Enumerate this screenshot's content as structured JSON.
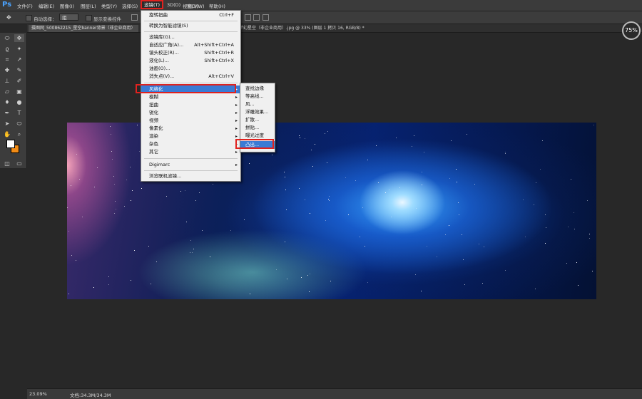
{
  "app": {
    "logo": "Ps"
  },
  "menubar": {
    "items": [
      "文件(F)",
      "编辑(E)",
      "图像(I)",
      "图层(L)",
      "类型(Y)",
      "选择(S)",
      "滤镜(T)",
      "3D(D)",
      "视图(V)",
      "窗口(W)",
      "帮助(H)"
    ]
  },
  "optbar": {
    "auto_select_label": "自动选择：",
    "auto_select_value": "组",
    "show_transform_label": "显示变换控件"
  },
  "tabs": {
    "left": "摄图网_500862215_星空banner背景（非企业商用）",
    "right": "梦幻星空（非企业商用）.jpg @ 33% (图层 1 拷贝 16, RGB/8) *"
  },
  "zoom_badge": "75%",
  "filter_menu": {
    "items": [
      {
        "label": "旋转扭曲",
        "shortcut": "Ctrl+F"
      },
      {
        "label": "转换为智能滤镜(S)",
        "shortcut": ""
      },
      {
        "label": "滤镜库(G)...",
        "shortcut": ""
      },
      {
        "label": "自适应广角(A)...",
        "shortcut": "Alt+Shift+Ctrl+A"
      },
      {
        "label": "镜头校正(R)...",
        "shortcut": "Shift+Ctrl+R"
      },
      {
        "label": "液化(L)...",
        "shortcut": "Shift+Ctrl+X"
      },
      {
        "label": "油画(O)...",
        "shortcut": ""
      },
      {
        "label": "消失点(V)...",
        "shortcut": "Alt+Ctrl+V"
      },
      {
        "label": "风格化",
        "shortcut": ""
      },
      {
        "label": "模糊",
        "shortcut": ""
      },
      {
        "label": "扭曲",
        "shortcut": ""
      },
      {
        "label": "锐化",
        "shortcut": ""
      },
      {
        "label": "视频",
        "shortcut": ""
      },
      {
        "label": "像素化",
        "shortcut": ""
      },
      {
        "label": "渲染",
        "shortcut": ""
      },
      {
        "label": "杂色",
        "shortcut": ""
      },
      {
        "label": "其它",
        "shortcut": ""
      },
      {
        "label": "Digimarc",
        "shortcut": ""
      },
      {
        "label": "浏览联机滤镜...",
        "shortcut": ""
      }
    ],
    "submenu_arrow": "▸"
  },
  "stylize_submenu": {
    "items": [
      "查找边缘",
      "等高线...",
      "风...",
      "浮雕效果...",
      "扩散...",
      "拼贴...",
      "曝光过度",
      "凸出..."
    ]
  },
  "status": {
    "zoom": "23.09%",
    "doc": "文档:34.3M/34.3M"
  },
  "colors": {
    "highlight": "#3a7bd5",
    "annotation": "#e0221f",
    "background_swatch": "#f28c16",
    "foreground_swatch": "#ffffff"
  }
}
